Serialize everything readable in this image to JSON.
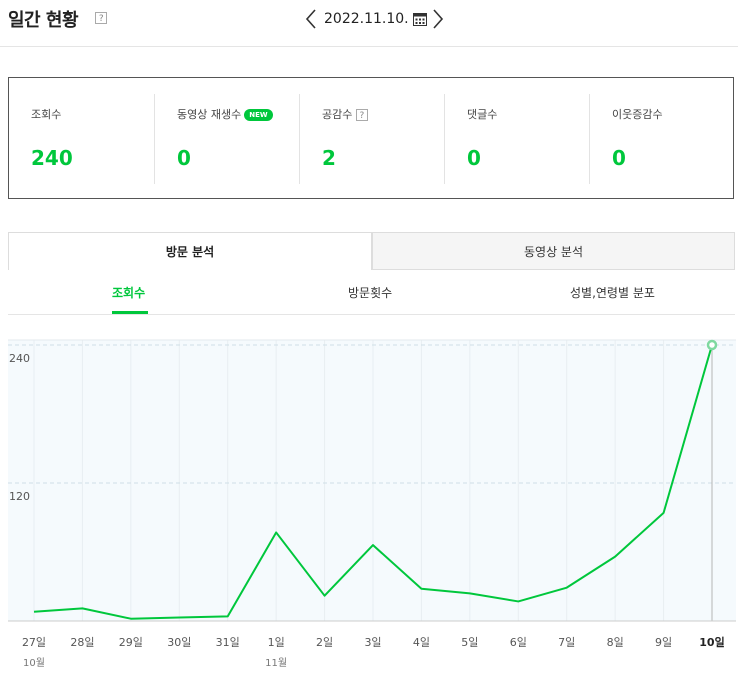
{
  "header": {
    "title": "일간 현황",
    "help": "?",
    "date": "2022.11.10."
  },
  "summary": [
    {
      "label": "조회수",
      "value": "240"
    },
    {
      "label": "동영상 재생수",
      "badge": "NEW",
      "value": "0"
    },
    {
      "label": "공감수",
      "help": "?",
      "value": "2"
    },
    {
      "label": "댓글수",
      "value": "0"
    },
    {
      "label": "이웃증감수",
      "value": "0"
    }
  ],
  "tabs": {
    "main": [
      "방문 분석",
      "동영상 분석"
    ],
    "sub": [
      "조회수",
      "방문횟수",
      "성별,연령별 분포"
    ]
  },
  "colors": {
    "accent": "#00c73c",
    "plot_bg": "#f5fafd"
  },
  "chart_data": {
    "type": "line",
    "x": [
      "27일",
      "28일",
      "29일",
      "30일",
      "31일",
      "1일",
      "2일",
      "3일",
      "4일",
      "5일",
      "6일",
      "7일",
      "8일",
      "9일",
      "10일"
    ],
    "month_labels": [
      {
        "index": 0,
        "text": "10월"
      },
      {
        "index": 5,
        "text": "11월"
      }
    ],
    "series": [
      {
        "values": [
          8,
          11,
          2,
          3,
          4,
          77,
          22,
          66,
          28,
          24,
          17,
          29,
          56,
          94,
          240
        ]
      }
    ],
    "yticks": [
      120,
      240
    ],
    "ylim": [
      0,
      240
    ],
    "highlight_index": 14,
    "grid": true
  }
}
